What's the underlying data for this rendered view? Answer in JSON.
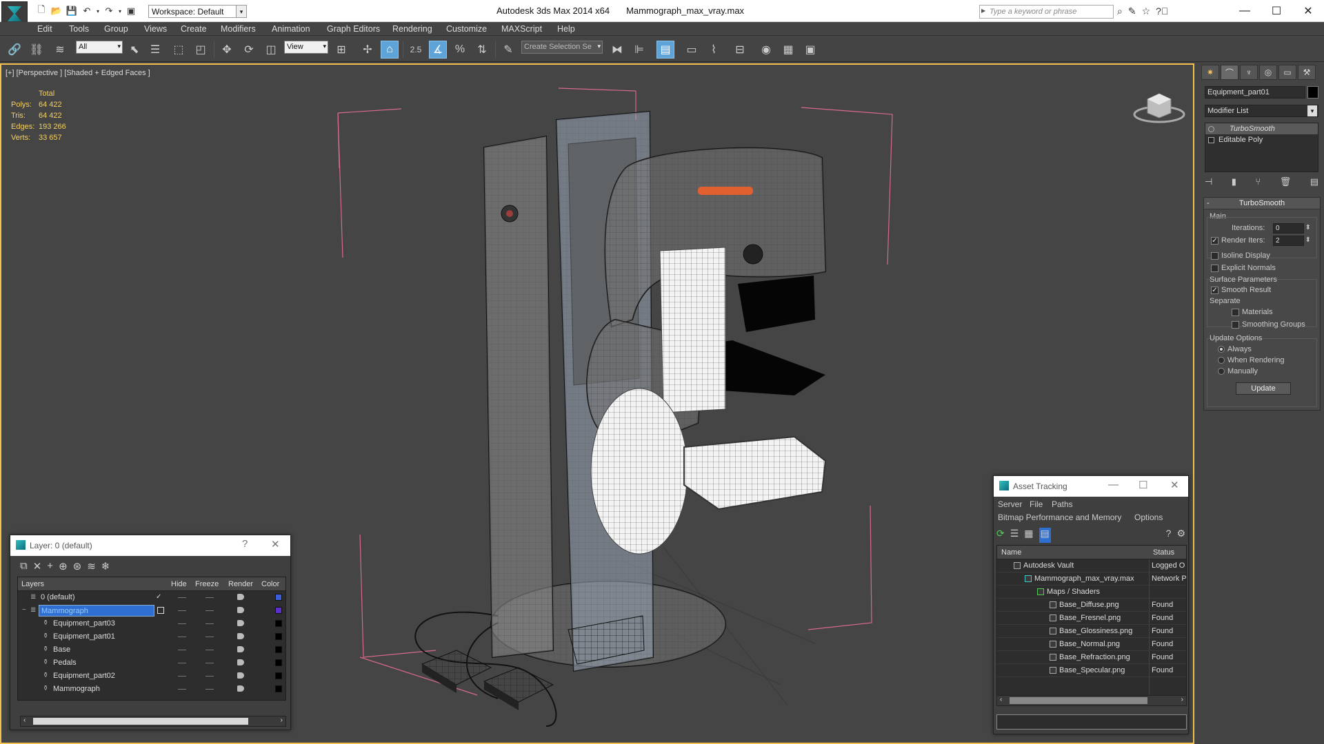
{
  "titlebar": {
    "workspace": "Workspace: Default",
    "app_name": "Autodesk 3ds Max  2014 x64",
    "file_name": "Mammograph_max_vray.max",
    "search_placeholder": "Type a keyword or phrase"
  },
  "menu": [
    "Edit",
    "Tools",
    "Group",
    "Views",
    "Create",
    "Modifiers",
    "Animation",
    "Graph Editors",
    "Rendering",
    "Customize",
    "MAXScript",
    "Help"
  ],
  "toolbar": {
    "filter_select": "All",
    "ref_coord": "View",
    "selection_set": "Create Selection Se",
    "snap_label": "2.5"
  },
  "viewport": {
    "label": "[+] [Perspective ] [Shaded + Edged Faces ]",
    "stats_header": "Total",
    "stats": [
      {
        "key": "Polys:",
        "value": "64 422"
      },
      {
        "key": "Tris:",
        "value": "64 422"
      },
      {
        "key": "Edges:",
        "value": "193 266"
      },
      {
        "key": "Verts:",
        "value": "33 657"
      }
    ]
  },
  "command_panel": {
    "object_name": "Equipment_part01",
    "modifier_list": "Modifier List",
    "stack": [
      "TurboSmooth",
      "Editable Poly"
    ],
    "rollout_title": "TurboSmooth",
    "main_label": "Main",
    "iterations_label": "Iterations:",
    "iterations_value": "0",
    "render_iters_label": "Render Iters:",
    "render_iters_value": "2",
    "isoline_label": "Isoline Display",
    "explicit_normals_label": "Explicit Normals",
    "surface_params_label": "Surface Parameters",
    "smooth_result_label": "Smooth Result",
    "separate_label": "Separate",
    "materials_label": "Materials",
    "smoothing_groups_label": "Smoothing Groups",
    "update_options_label": "Update Options",
    "always_label": "Always",
    "when_rendering_label": "When Rendering",
    "manually_label": "Manually",
    "update_button": "Update"
  },
  "layer_dialog": {
    "title": "Layer: 0 (default)",
    "help": "?",
    "columns": {
      "layers": "Layers",
      "hide": "Hide",
      "freeze": "Freeze",
      "render": "Render",
      "color": "Color"
    },
    "rows": [
      {
        "name": "0 (default)",
        "color": "#3a5fd8"
      },
      {
        "name": "Mammograph",
        "color": "#5a30c8"
      },
      {
        "name": "Equipment_part03",
        "color": "#000000"
      },
      {
        "name": "Equipment_part01",
        "color": "#000000"
      },
      {
        "name": "Base",
        "color": "#000000"
      },
      {
        "name": "Pedals",
        "color": "#000000"
      },
      {
        "name": "Equipment_part02",
        "color": "#000000"
      },
      {
        "name": "Mammograph",
        "color": "#000000"
      }
    ]
  },
  "asset_tracking": {
    "title": "Asset Tracking",
    "menu1": [
      "Server",
      "File",
      "Paths"
    ],
    "menu2": [
      "Bitmap Performance and Memory",
      "Options"
    ],
    "columns": {
      "name": "Name",
      "status": "Status"
    },
    "rows": [
      {
        "name": "Autodesk Vault",
        "status": "Logged O"
      },
      {
        "name": "Mammograph_max_vray.max",
        "status": "Network P"
      },
      {
        "name": "Maps / Shaders",
        "status": ""
      },
      {
        "name": "Base_Diffuse.png",
        "status": "Found"
      },
      {
        "name": "Base_Fresnel.png",
        "status": "Found"
      },
      {
        "name": "Base_Glossiness.png",
        "status": "Found"
      },
      {
        "name": "Base_Normal.png",
        "status": "Found"
      },
      {
        "name": "Base_Refraction.png",
        "status": "Found"
      },
      {
        "name": "Base_Specular.png",
        "status": "Found"
      }
    ]
  }
}
